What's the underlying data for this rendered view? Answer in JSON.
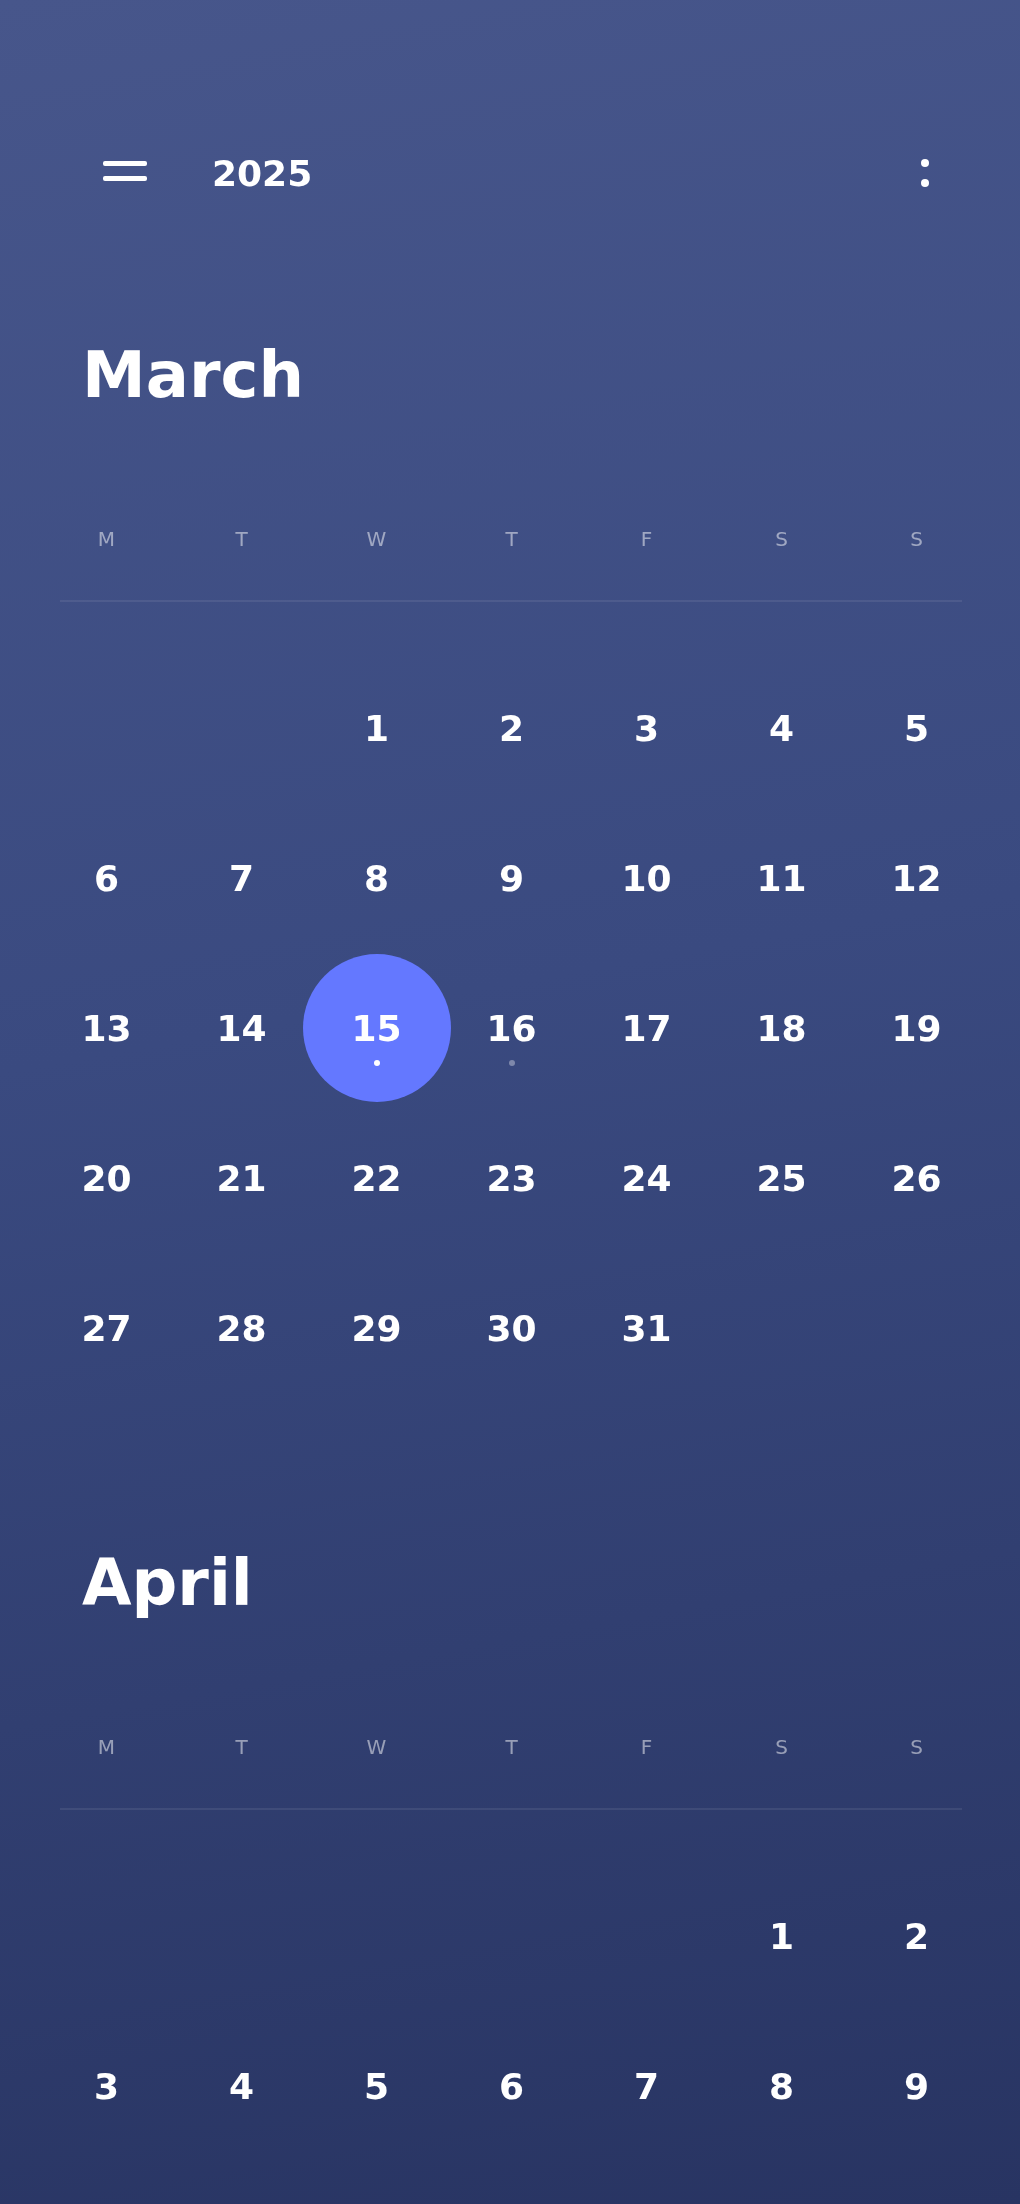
{
  "header": {
    "year": "2025"
  },
  "months": [
    {
      "name": "March",
      "weekdays": [
        "M",
        "T",
        "W",
        "T",
        "F",
        "S",
        "S"
      ],
      "weeks": [
        {
          "kind": "first",
          "days": [
            {
              "day": "1",
              "selected": false,
              "event": false
            },
            {
              "day": "2",
              "selected": false,
              "event": false
            },
            {
              "day": "3",
              "selected": false,
              "event": false
            },
            {
              "day": "4",
              "selected": false,
              "event": false
            },
            {
              "day": "5",
              "selected": false,
              "event": false
            }
          ]
        },
        {
          "kind": "full",
          "days": [
            {
              "day": "6",
              "selected": false,
              "event": false
            },
            {
              "day": "7",
              "selected": false,
              "event": false
            },
            {
              "day": "8",
              "selected": false,
              "event": false
            },
            {
              "day": "9",
              "selected": false,
              "event": false
            },
            {
              "day": "10",
              "selected": false,
              "event": false
            },
            {
              "day": "11",
              "selected": false,
              "event": false
            },
            {
              "day": "12",
              "selected": false,
              "event": false
            }
          ]
        },
        {
          "kind": "full",
          "days": [
            {
              "day": "13",
              "selected": false,
              "event": false
            },
            {
              "day": "14",
              "selected": false,
              "event": false
            },
            {
              "day": "15",
              "selected": true,
              "event": true
            },
            {
              "day": "16",
              "selected": false,
              "event": true
            },
            {
              "day": "17",
              "selected": false,
              "event": false
            },
            {
              "day": "18",
              "selected": false,
              "event": false
            },
            {
              "day": "19",
              "selected": false,
              "event": false
            }
          ]
        },
        {
          "kind": "full",
          "days": [
            {
              "day": "20",
              "selected": false,
              "event": false
            },
            {
              "day": "21",
              "selected": false,
              "event": false
            },
            {
              "day": "22",
              "selected": false,
              "event": false
            },
            {
              "day": "23",
              "selected": false,
              "event": false
            },
            {
              "day": "24",
              "selected": false,
              "event": false
            },
            {
              "day": "25",
              "selected": false,
              "event": false
            },
            {
              "day": "26",
              "selected": false,
              "event": false
            }
          ]
        },
        {
          "kind": "last",
          "days": [
            {
              "day": "27",
              "selected": false,
              "event": false
            },
            {
              "day": "28",
              "selected": false,
              "event": false
            },
            {
              "day": "29",
              "selected": false,
              "event": false
            },
            {
              "day": "30",
              "selected": false,
              "event": false
            },
            {
              "day": "31",
              "selected": false,
              "event": false
            }
          ]
        }
      ]
    },
    {
      "name": "April",
      "weekdays": [
        "M",
        "T",
        "W",
        "T",
        "F",
        "S",
        "S"
      ],
      "weeks": [
        {
          "kind": "first",
          "days": [
            {
              "day": "1",
              "selected": false,
              "event": false
            },
            {
              "day": "2",
              "selected": false,
              "event": false
            }
          ]
        },
        {
          "kind": "full",
          "days": [
            {
              "day": "3",
              "selected": false,
              "event": false
            },
            {
              "day": "4",
              "selected": false,
              "event": false
            },
            {
              "day": "5",
              "selected": false,
              "event": false
            },
            {
              "day": "6",
              "selected": false,
              "event": false
            },
            {
              "day": "7",
              "selected": false,
              "event": false
            },
            {
              "day": "8",
              "selected": false,
              "event": false
            },
            {
              "day": "9",
              "selected": false,
              "event": false
            }
          ]
        }
      ]
    }
  ]
}
